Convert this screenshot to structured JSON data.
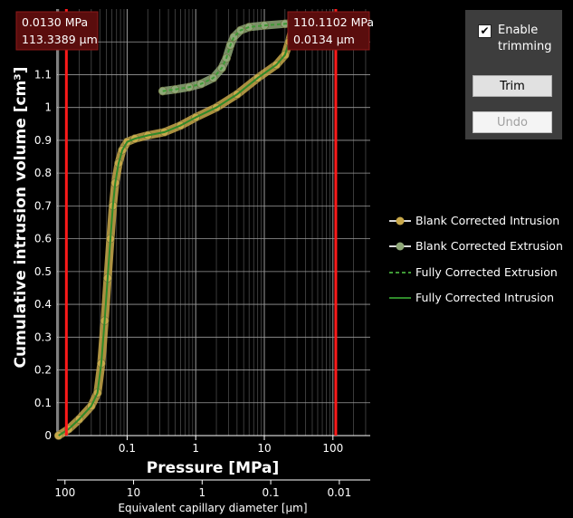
{
  "chart_data": {
    "type": "line",
    "xscale": "log",
    "xlabel": "Pressure [MPa]",
    "ylabel": "Cumulative intrusion volume [cm³]",
    "x2label": "Equivalent capillary diameter [µm]",
    "xlim": [
      0.0095,
      350
    ],
    "ylim": [
      0,
      1.3
    ],
    "x_ticks": [
      {
        "value": 0.1,
        "label": "0.1"
      },
      {
        "value": 1,
        "label": "1"
      },
      {
        "value": 10,
        "label": "10"
      },
      {
        "value": 100,
        "label": "100"
      }
    ],
    "x2_ticks": [
      {
        "value": 0.0124,
        "label": "100"
      },
      {
        "value": 0.124,
        "label": "10"
      },
      {
        "value": 1.24,
        "label": "1"
      },
      {
        "value": 12.4,
        "label": "0.1"
      },
      {
        "value": 124,
        "label": "0.01"
      }
    ],
    "y_ticks": [
      0,
      0.1,
      0.2,
      0.3,
      0.4,
      0.5,
      0.6,
      0.7,
      0.8,
      0.9,
      1,
      1.1,
      1.2
    ],
    "grid": true,
    "legend_position": "right",
    "series": [
      {
        "name": "Blank Corrected Intrusion",
        "style": "markers",
        "color": "#c8a84a",
        "x": [
          0.01,
          0.014,
          0.02,
          0.03,
          0.037,
          0.042,
          0.047,
          0.052,
          0.057,
          0.062,
          0.067,
          0.075,
          0.085,
          0.1,
          0.13,
          0.2,
          0.35,
          0.6,
          1,
          2,
          4,
          8,
          15,
          20,
          23,
          25,
          27,
          30,
          40,
          60,
          100,
          150,
          200,
          300
        ],
        "values": [
          0,
          0.02,
          0.05,
          0.09,
          0.13,
          0.22,
          0.35,
          0.48,
          0.6,
          0.7,
          0.77,
          0.83,
          0.87,
          0.895,
          0.905,
          0.915,
          0.925,
          0.945,
          0.97,
          1.0,
          1.04,
          1.09,
          1.13,
          1.16,
          1.2,
          1.23,
          1.245,
          1.25,
          1.255,
          1.26,
          1.262,
          1.265,
          1.268,
          1.27
        ]
      },
      {
        "name": "Blank Corrected Extrusion",
        "style": "markers",
        "color": "#8fa878",
        "x": [
          0.33,
          0.5,
          0.8,
          1.2,
          1.8,
          2.4,
          2.8,
          3.2,
          3.6,
          4.5,
          6,
          10,
          20,
          40,
          80,
          150,
          300
        ],
        "values": [
          1.05,
          1.055,
          1.062,
          1.072,
          1.09,
          1.12,
          1.15,
          1.19,
          1.215,
          1.235,
          1.245,
          1.25,
          1.255,
          1.26,
          1.263,
          1.266,
          1.27
        ]
      },
      {
        "name": "Fully Corrected Extrusion",
        "style": "dashed",
        "color": "#3f9a36",
        "x": [
          0.33,
          0.5,
          0.8,
          1.2,
          1.8,
          2.4,
          2.8,
          3.2,
          3.6,
          4.5,
          6,
          10,
          20,
          40,
          80,
          150,
          300
        ],
        "values": [
          1.05,
          1.055,
          1.062,
          1.072,
          1.09,
          1.12,
          1.15,
          1.19,
          1.215,
          1.235,
          1.245,
          1.25,
          1.255,
          1.26,
          1.263,
          1.266,
          1.27
        ]
      },
      {
        "name": "Fully Corrected Intrusion",
        "style": "solid",
        "color": "#2f8a2a",
        "x": [
          0.01,
          0.014,
          0.02,
          0.03,
          0.037,
          0.042,
          0.047,
          0.052,
          0.057,
          0.062,
          0.067,
          0.075,
          0.085,
          0.1,
          0.13,
          0.2,
          0.35,
          0.6,
          1,
          2,
          4,
          8,
          15,
          20,
          23,
          25,
          27,
          30,
          40,
          60,
          100,
          150,
          200,
          300
        ],
        "values": [
          0,
          0.02,
          0.05,
          0.09,
          0.13,
          0.22,
          0.35,
          0.48,
          0.6,
          0.7,
          0.77,
          0.83,
          0.87,
          0.895,
          0.905,
          0.915,
          0.925,
          0.945,
          0.97,
          1.0,
          1.04,
          1.09,
          1.13,
          1.16,
          1.2,
          1.23,
          1.245,
          1.25,
          1.255,
          1.26,
          1.262,
          1.265,
          1.268,
          1.27
        ]
      }
    ],
    "trim_markers": [
      {
        "name": "left",
        "pressure": 0.013,
        "label_line1": "0.0130 MPa",
        "label_line2": "113.3389 µm"
      },
      {
        "name": "right",
        "pressure": 110.1102,
        "label_line1": "110.1102 MPa",
        "label_line2": "0.0134 µm"
      }
    ],
    "marker_color": "#ff1a1a"
  },
  "trim_panel": {
    "enable_label": "Enable trimming",
    "enable_checked": true,
    "trim_label": "Trim",
    "undo_label": "Undo"
  }
}
